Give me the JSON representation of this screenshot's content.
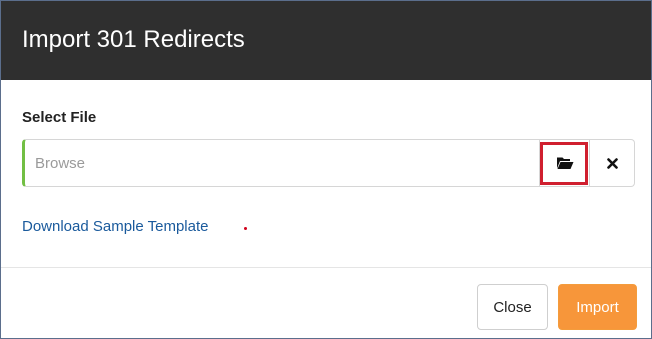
{
  "dialog": {
    "title": "Import 301 Redirects"
  },
  "file_field": {
    "label": "Select File",
    "placeholder": "Browse",
    "value": "",
    "browse_icon": "folder-open-icon",
    "clear_icon": "close-icon"
  },
  "links": {
    "download_template": "Download Sample Template"
  },
  "footer": {
    "close_label": "Close",
    "import_label": "Import"
  },
  "colors": {
    "header_bg": "#2f2f2f",
    "accent_green": "#72bf44",
    "link_blue": "#1a5a9c",
    "import_orange": "#f7963a",
    "highlight_red": "#d01f2f"
  }
}
